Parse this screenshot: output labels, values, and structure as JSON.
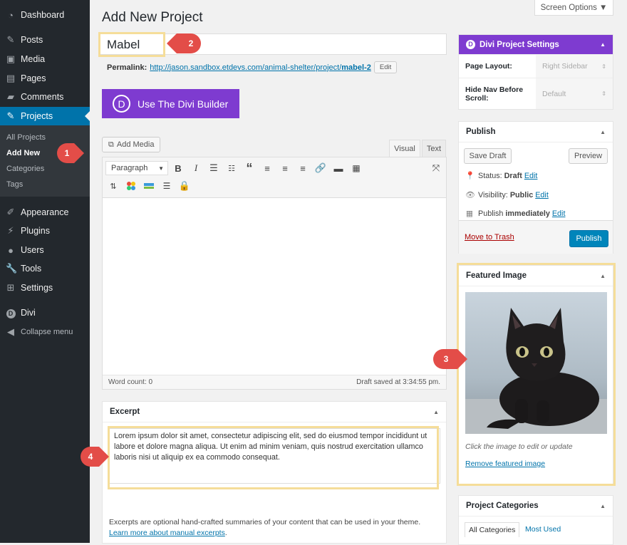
{
  "sidebar": {
    "items": [
      {
        "label": "Dashboard",
        "icon": "dashboard-icon"
      },
      {
        "label": "Posts",
        "icon": "pin-icon"
      },
      {
        "label": "Media",
        "icon": "media-icon"
      },
      {
        "label": "Pages",
        "icon": "pages-icon"
      },
      {
        "label": "Comments",
        "icon": "comment-icon"
      },
      {
        "label": "Projects",
        "icon": "pin-icon",
        "active": true
      },
      {
        "label": "Appearance",
        "icon": "brush-icon"
      },
      {
        "label": "Plugins",
        "icon": "plug-icon"
      },
      {
        "label": "Users",
        "icon": "user-icon"
      },
      {
        "label": "Tools",
        "icon": "wrench-icon"
      },
      {
        "label": "Settings",
        "icon": "settings-icon"
      },
      {
        "label": "Divi",
        "icon": "divi-icon"
      },
      {
        "label": "Collapse menu",
        "icon": "collapse-icon"
      }
    ],
    "submenu": [
      "All Projects",
      "Add New",
      "Categories",
      "Tags"
    ]
  },
  "header": {
    "screen_options": "Screen Options ▼",
    "title": "Add New Project"
  },
  "post": {
    "title_value": "Mabel",
    "permalink_label": "Permalink:",
    "permalink_url": "http://jason.sandbox.etdevs.com/animal-shelter/project/",
    "permalink_slug": "mabel-2",
    "permalink_edit": "Edit",
    "divi_builder_label": "Use The Divi Builder"
  },
  "editor": {
    "add_media": "Add Media",
    "tab_visual": "Visual",
    "tab_text": "Text",
    "format": "Paragraph",
    "word_count": "Word count: 0",
    "draft_saved": "Draft saved at 3:34:55 pm."
  },
  "excerpt": {
    "title": "Excerpt",
    "text": "Lorem ipsum dolor sit amet, consectetur adipiscing elit, sed do eiusmod tempor incididunt ut labore et dolore magna aliqua. Ut enim ad minim veniam, quis nostrud exercitation ullamco laboris nisi ut aliquip ex ea commodo consequat.",
    "help": "Excerpts are optional hand-crafted summaries of your content that can be used in your theme.",
    "help_link": "Learn more about manual excerpts",
    "help_end": "."
  },
  "divi_settings": {
    "title": "Divi Project Settings",
    "page_layout_label": "Page Layout:",
    "page_layout_value": "Right Sidebar",
    "hide_nav_label": "Hide Nav Before Scroll:",
    "hide_nav_value": "Default"
  },
  "publish": {
    "title": "Publish",
    "save_draft": "Save Draft",
    "preview": "Preview",
    "status_label": "Status:",
    "status_value": "Draft",
    "visibility_label": "Visibility:",
    "visibility_value": "Public",
    "publish_label": "Publish",
    "publish_value": "immediately",
    "edit": "Edit",
    "move_to_trash": "Move to Trash",
    "publish_button": "Publish"
  },
  "featured": {
    "title": "Featured Image",
    "caption": "Click the image to edit or update",
    "remove": "Remove featured image"
  },
  "categories": {
    "title": "Project Categories",
    "tab_all": "All Categories",
    "tab_used": "Most Used"
  },
  "badges": [
    "1",
    "2",
    "3",
    "4"
  ],
  "colors": {
    "accent": "#0073aa",
    "divi_purple": "#7e3bd0",
    "highlight": "#f5dd99",
    "badge": "#e34d48"
  }
}
